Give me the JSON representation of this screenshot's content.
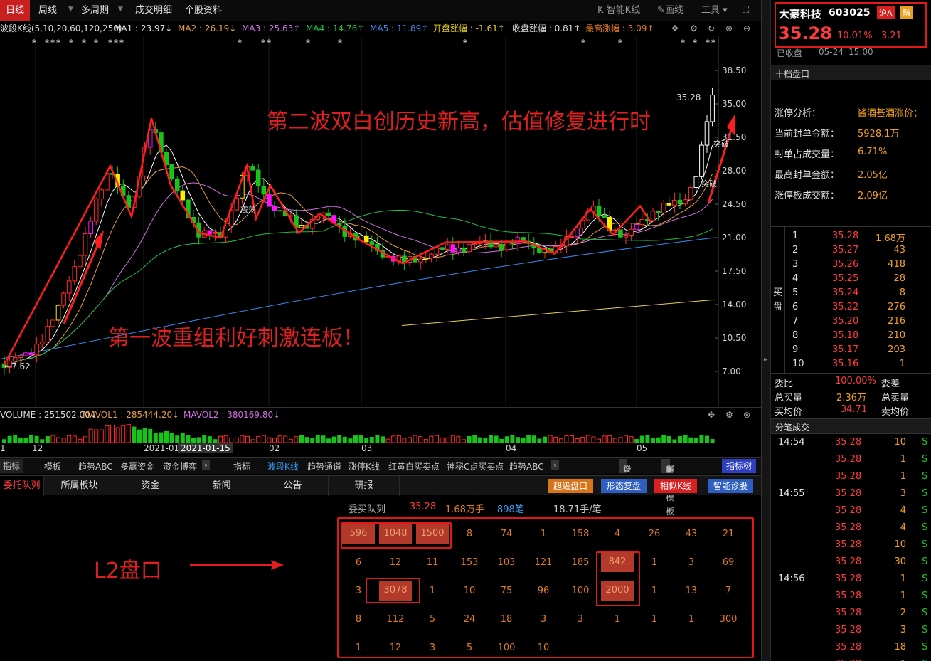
{
  "toolbar": {
    "tabs": [
      "日线",
      "周线",
      "多周期",
      "成交明细",
      "个股资料"
    ],
    "right": [
      "智能K线",
      "画线",
      "工具"
    ]
  },
  "ma": {
    "title": "波段K线(5,10,20,60,120,250)",
    "ma1": "MA1 : 23.97↓",
    "ma2": "MA2 : 26.19↓",
    "ma3": "MA3 : 25.63↑",
    "ma4": "MA4 : 14.76↑",
    "ma5": "MA5 : 11.89↑",
    "open_chg": "开盘涨幅 : -1.61↑",
    "close_chg": "收盘涨幅 : 0.81↑",
    "high_chg": "最高涨幅 : 3.09↑"
  },
  "chart": {
    "y_ticks": [
      "38.50",
      "35.00",
      "31.50",
      "28.00",
      "24.50",
      "21.00",
      "17.50",
      "14.00",
      "10.50",
      "7.00"
    ],
    "y_values": [
      38.5,
      35,
      31.5,
      28,
      24.5,
      21,
      17.5,
      14,
      10.5,
      7
    ],
    "high_label": "35.28",
    "low_label": "7.62",
    "anno_top": "第二波双白创历史新高，估值修复进行时",
    "anno_mid": "第一波重组利好刺激连板！",
    "anno_l2": "L2盘口",
    "tag_tupo1": "突破",
    "tag_tupo2": "突破",
    "tag_zhen": "震荡"
  },
  "volume": {
    "vol": "VOLUME : 251502.00↓",
    "mavol1": "MAVOL1 : 285444.20↓",
    "mavol2": "MAVOL2 : 380169.80↓"
  },
  "xaxis": [
    "12",
    "2021-01",
    "2021-01-15",
    "02",
    "03",
    "04",
    "05"
  ],
  "indbar": [
    "指标",
    "模板",
    "趋势ABC",
    "多赢资金",
    "资金博弈",
    "指标",
    "波段K线",
    "趋势通道",
    "涨停K线",
    "红黄白买卖点",
    "神秘C点买卖点",
    "趋势ABC",
    "设置",
    "保存模板",
    "指标树"
  ],
  "tabs": [
    "委托队列",
    "所属板块",
    "资金",
    "新闻",
    "公告",
    "研报"
  ],
  "tab_buttons": [
    "超级盘口",
    "形态复盘",
    "相似K线",
    "智能诊股"
  ],
  "queue": {
    "label": "委买队列",
    "price": "35.28",
    "volume": "1.68万手",
    "count": "898笔",
    "avg": "18.71手/笔",
    "dashes": [
      "---",
      "---",
      "---",
      "---"
    ],
    "rows": [
      [
        "596",
        "1048",
        "1500",
        "8",
        "74",
        "1",
        "158",
        "4",
        "26",
        "43",
        "21"
      ],
      [
        "6",
        "12",
        "11",
        "153",
        "103",
        "121",
        "185",
        "842",
        "1",
        "3",
        "69"
      ],
      [
        "3",
        "3078",
        "1",
        "10",
        "75",
        "96",
        "100",
        "2000",
        "1",
        "13",
        "7"
      ],
      [
        "8",
        "112",
        "5",
        "24",
        "18",
        "3",
        "3",
        "1",
        "1",
        "1",
        "300"
      ],
      [
        "1",
        "12",
        "3",
        "5",
        "100",
        "10"
      ]
    ]
  },
  "stock": {
    "name": "大豪科技",
    "code": "603025",
    "market": "沪A",
    "tag": "融",
    "price": "35.28",
    "pct": "10.01%",
    "chg": "3.21",
    "status": "已收盘",
    "date": "05-24",
    "time": "15:00"
  },
  "panel_title": "十档盘口",
  "limit": {
    "items": [
      {
        "label": "涨停分析：",
        "value": "酱酒基酒涨价；"
      },
      {
        "label": "当前封单金额：",
        "value": "5928.1万"
      },
      {
        "label": "封单占成交量：",
        "value": "6.71%"
      },
      {
        "label": "最高封单金额：",
        "value": "2.05亿"
      },
      {
        "label": "涨停板成交额：",
        "value": "2.09亿"
      }
    ]
  },
  "orderbook": {
    "side_label": "买盘",
    "rows": [
      [
        "1",
        "35.28",
        "1.68万"
      ],
      [
        "2",
        "35.27",
        "43"
      ],
      [
        "3",
        "35.26",
        "418"
      ],
      [
        "4",
        "35.25",
        "28"
      ],
      [
        "5",
        "35.24",
        "8"
      ],
      [
        "6",
        "35.22",
        "276"
      ],
      [
        "7",
        "35.20",
        "216"
      ],
      [
        "8",
        "35.18",
        "210"
      ],
      [
        "9",
        "35.17",
        "203"
      ],
      [
        "10",
        "35.16",
        "1"
      ]
    ]
  },
  "summary": {
    "weibi_l": "委比",
    "weibi_v": "100.00%",
    "weicha_l": "委差",
    "buy_l": "总买量",
    "buy_v": "2.36万",
    "sell_l": "总卖量",
    "buyavg_l": "买均价",
    "buyavg_v": "34.71",
    "sellavg_l": "卖均价"
  },
  "trades_title": "分笔成交",
  "trades": [
    {
      "t": "14:54",
      "p": "35.28",
      "v": "10",
      "s": "S"
    },
    {
      "t": "",
      "p": "35.28",
      "v": "1",
      "s": "S"
    },
    {
      "t": "",
      "p": "35.28",
      "v": "1",
      "s": "S"
    },
    {
      "t": "14:55",
      "p": "35.28",
      "v": "3",
      "s": "S"
    },
    {
      "t": "",
      "p": "35.28",
      "v": "4",
      "s": "S"
    },
    {
      "t": "",
      "p": "35.28",
      "v": "4",
      "s": "S"
    },
    {
      "t": "",
      "p": "35.28",
      "v": "10",
      "s": "S"
    },
    {
      "t": "",
      "p": "35.28",
      "v": "30",
      "s": "S"
    },
    {
      "t": "14:56",
      "p": "35.28",
      "v": "1",
      "s": "S"
    },
    {
      "t": "",
      "p": "35.28",
      "v": "1",
      "s": "S"
    },
    {
      "t": "",
      "p": "35.28",
      "v": "2",
      "s": "S"
    },
    {
      "t": "",
      "p": "35.28",
      "v": "3",
      "s": "S"
    },
    {
      "t": "",
      "p": "35.28",
      "v": "18",
      "s": "S"
    },
    {
      "t": "",
      "p": "35.28",
      "v": "1",
      "s": "S"
    }
  ],
  "colors": {
    "up": "#ff3b3b",
    "down": "#19c41a",
    "accent": "#c81f1f",
    "annotation": "#e02020"
  }
}
